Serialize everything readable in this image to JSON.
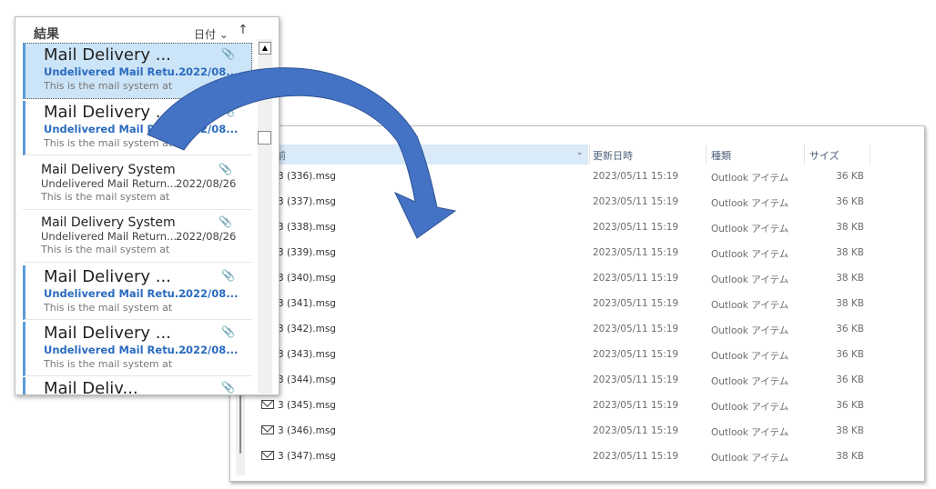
{
  "outlook": {
    "title": "結果",
    "sort_label": "日付",
    "sort_dir_icon": "arrow-up-icon",
    "items": [
      {
        "from": "Mail Delivery ...",
        "subject": "Undelivered Mail Retu...",
        "date": "2022/08...",
        "preview": "This is the mail system at",
        "unread": true,
        "selected": true
      },
      {
        "from": "Mail Delivery ...",
        "subject": "Undelivered Mail Retu...",
        "date": "2022/08...",
        "preview": "This is the mail system at",
        "unread": true,
        "selected": false
      },
      {
        "from": "Mail Delivery System",
        "subject": "Undelivered Mail Return...",
        "date": "2022/08/26",
        "preview": "This is the mail system at",
        "unread": false,
        "selected": false
      },
      {
        "from": "Mail Delivery System",
        "subject": "Undelivered Mail Return...",
        "date": "2022/08/26",
        "preview": "This is the mail system at",
        "unread": false,
        "selected": false
      },
      {
        "from": "Mail Delivery ...",
        "subject": "Undelivered Mail Retu...",
        "date": "2022/08...",
        "preview": "This is the mail system at",
        "unread": true,
        "selected": false
      },
      {
        "from": "Mail Delivery ...",
        "subject": "Undelivered Mail Retu...",
        "date": "2022/08...",
        "preview": "This is the mail system at",
        "unread": true,
        "selected": false
      },
      {
        "from": "Mail Deliv...",
        "subject": "",
        "date": "",
        "preview": "",
        "unread": true,
        "selected": false
      }
    ]
  },
  "explorer": {
    "columns": {
      "name": "前",
      "modified": "更新日時",
      "type": "種類",
      "size": "サイズ"
    },
    "files": [
      {
        "name": "3 (336).msg",
        "modified": "2023/05/11 15:19",
        "type": "Outlook アイテム",
        "size": "36 KB"
      },
      {
        "name": "3 (337).msg",
        "modified": "2023/05/11 15:19",
        "type": "Outlook アイテム",
        "size": "36 KB"
      },
      {
        "name": "3 (338).msg",
        "modified": "2023/05/11 15:19",
        "type": "Outlook アイテム",
        "size": "38 KB"
      },
      {
        "name": "3 (339).msg",
        "modified": "2023/05/11 15:19",
        "type": "Outlook アイテム",
        "size": "38 KB"
      },
      {
        "name": "3 (340).msg",
        "modified": "2023/05/11 15:19",
        "type": "Outlook アイテム",
        "size": "38 KB"
      },
      {
        "name": "3 (341).msg",
        "modified": "2023/05/11 15:19",
        "type": "Outlook アイテム",
        "size": "38 KB"
      },
      {
        "name": "3 (342).msg",
        "modified": "2023/05/11 15:19",
        "type": "Outlook アイテム",
        "size": "36 KB"
      },
      {
        "name": "3 (343).msg",
        "modified": "2023/05/11 15:19",
        "type": "Outlook アイテム",
        "size": "36 KB"
      },
      {
        "name": "3 (344).msg",
        "modified": "2023/05/11 15:19",
        "type": "Outlook アイテム",
        "size": "36 KB"
      },
      {
        "name": "3 (345).msg",
        "modified": "2023/05/11 15:19",
        "type": "Outlook アイテム",
        "size": "36 KB"
      },
      {
        "name": "3 (346).msg",
        "modified": "2023/05/11 15:19",
        "type": "Outlook アイテム",
        "size": "38 KB"
      },
      {
        "name": "3 (347).msg",
        "modified": "2023/05/11 15:19",
        "type": "Outlook アイテム",
        "size": "38 KB"
      }
    ]
  },
  "colors": {
    "arrow": "#4472c4",
    "arrow_dark": "#2f5597",
    "selection": "#cce4f7",
    "unread_accent": "#2a6bbf"
  }
}
